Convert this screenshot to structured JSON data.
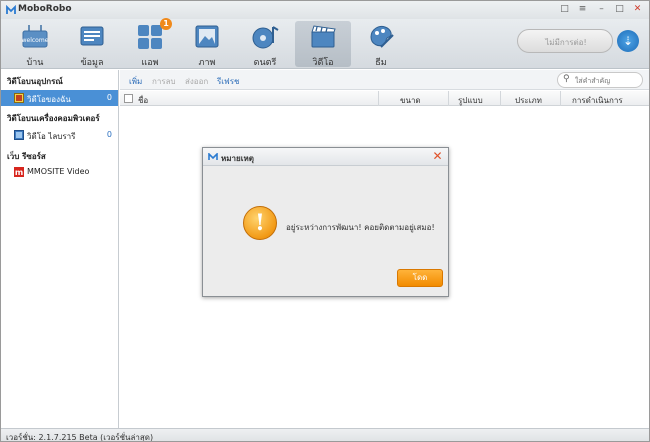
{
  "app": {
    "title": "MoboRobo"
  },
  "toolbar": {
    "tabs": [
      {
        "label": "บ้าน",
        "icon": "home-icon"
      },
      {
        "label": "ข้อมูล",
        "icon": "data-icon"
      },
      {
        "label": "แอพ",
        "icon": "apps-icon",
        "badge": "1"
      },
      {
        "label": "ภาพ",
        "icon": "photo-icon"
      },
      {
        "label": "ดนตรี",
        "icon": "music-icon"
      },
      {
        "label": "วิดีโอ",
        "icon": "video-icon",
        "active": true
      },
      {
        "label": "ธีม",
        "icon": "theme-icon"
      }
    ],
    "status_text": "ไม่มีการต่อ!"
  },
  "sidebar": {
    "header1": "วิดีโอบนอุปกรณ์",
    "item1": {
      "label": "วิดีโอของฉัน",
      "count": "0"
    },
    "header2": "วิดีโอบนเครื่องคอมพิวเตอร์",
    "item2": {
      "label": "วิดีโอ ไลบรารี",
      "count": "0"
    },
    "header3": "เว็บ รีซอร์ส",
    "item3": {
      "label": "MMOSITE Video"
    }
  },
  "actions": {
    "add": "เพิ่ม",
    "delete": "การลบ",
    "export": "ส่งออก",
    "refresh": "รีเฟรช"
  },
  "search": {
    "placeholder": "ใส่คำสำคัญ"
  },
  "table": {
    "columns": [
      "ชื่อ",
      "ขนาด",
      "รูปแบบ",
      "ประเภท",
      "การดำเนินการ"
    ]
  },
  "dialog": {
    "title": "หมายเหตุ",
    "message": "อยู่ระหว่างการพัฒนา! คอยติดตามอยู่เสมอ!",
    "ok_label": "โดด"
  },
  "statusbar": {
    "version": "เวอร์ชั่น: 2.1.7.215 Beta (เวอร์ชั่นล่าสุด)"
  },
  "colors": {
    "accent": "#4a90d6",
    "warning": "#f29a16",
    "ok_button": "#f28b00"
  }
}
